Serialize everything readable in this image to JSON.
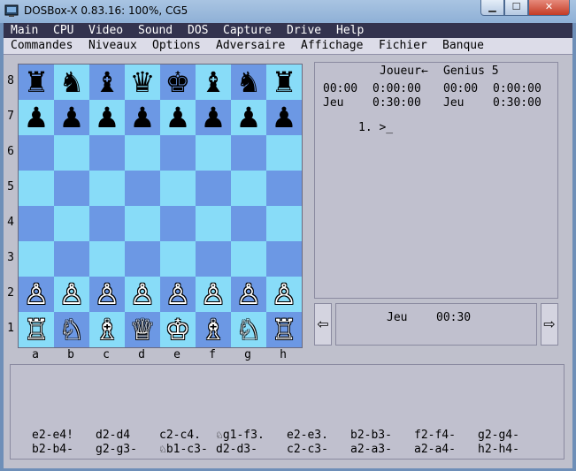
{
  "window": {
    "title": "DOSBox-X 0.83.16: 100%, CG5",
    "min_icon": "minimize-icon",
    "max_icon": "maximize-icon",
    "close_icon": "close-icon"
  },
  "host_menu": [
    "Main",
    "CPU",
    "Video",
    "Sound",
    "DOS",
    "Capture",
    "Drive",
    "Help"
  ],
  "game_menu": [
    "Commandes",
    "Niveaux",
    "Options",
    "Adversaire",
    "Affichage",
    "Fichier",
    "Banque"
  ],
  "board": {
    "ranks": [
      "8",
      "7",
      "6",
      "5",
      "4",
      "3",
      "2",
      "1"
    ],
    "files": [
      "a",
      "b",
      "c",
      "d",
      "e",
      "f",
      "g",
      "h"
    ],
    "rows": [
      [
        "♜",
        "♞",
        "♝",
        "♛",
        "♚",
        "♝",
        "♞",
        "♜"
      ],
      [
        "♟",
        "♟",
        "♟",
        "♟",
        "♟",
        "♟",
        "♟",
        "♟"
      ],
      [
        "",
        "",
        "",
        "",
        "",
        "",
        "",
        ""
      ],
      [
        "",
        "",
        "",
        "",
        "",
        "",
        "",
        ""
      ],
      [
        "",
        "",
        "",
        "",
        "",
        "",
        "",
        ""
      ],
      [
        "",
        "",
        "",
        "",
        "",
        "",
        "",
        ""
      ],
      [
        "♙",
        "♙",
        "♙",
        "♙",
        "♙",
        "♙",
        "♙",
        "♙"
      ],
      [
        "♖",
        "♘",
        "♗",
        "♕",
        "♔",
        "♗",
        "♘",
        "♖"
      ]
    ],
    "light_color": "#88dcf8",
    "dark_color": "#6c98e4"
  },
  "info": {
    "player_left": "Joueur←",
    "player_right": "Genius 5",
    "left_time1": "00:00",
    "left_time2": "0:00:00",
    "right_time1": "00:00",
    "right_time2": "0:00:00",
    "left_label": "Jeu",
    "left_limit": "0:30:00",
    "right_label": "Jeu",
    "right_limit": "0:30:00",
    "move_prompt": "1. >_"
  },
  "nav": {
    "left_arrow": "⇦",
    "right_arrow": "⇨",
    "mode": "Jeu",
    "time": "00:30"
  },
  "moves": [
    [
      "e2-e4!",
      "d2-d4",
      "c2-c4.",
      "♘g1-f3.",
      "e2-e3.",
      "b2-b3-",
      "f2-f4-",
      "g2-g4-"
    ],
    [
      "b2-b4-",
      "g2-g3-",
      "♘b1-c3-",
      "d2-d3-",
      "c2-c3-",
      "a2-a3-",
      "a2-a4-",
      "h2-h4-"
    ]
  ]
}
